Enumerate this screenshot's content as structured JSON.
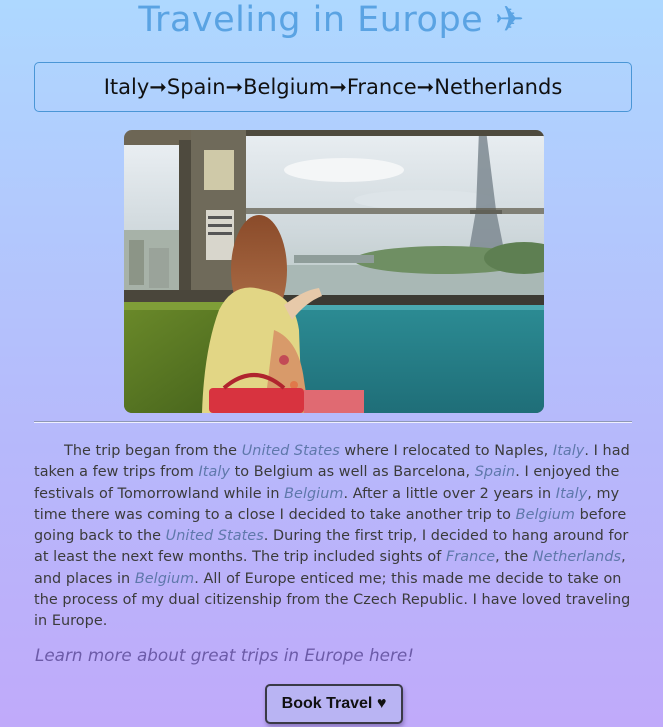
{
  "page": {
    "title": "Traveling in Europe ✈"
  },
  "route": {
    "text": "Italy➞Spain➞Belgium➞France➞Netherlands"
  },
  "photo": {
    "description_icon": "photo-woman-train-eiffel-tower"
  },
  "story": {
    "segments": [
      {
        "text": "The trip began from the ",
        "place": false
      },
      {
        "text": "United States",
        "place": true
      },
      {
        "text": " where I relocated to Naples, ",
        "place": false
      },
      {
        "text": "Italy",
        "place": true
      },
      {
        "text": ". I had taken a few trips from ",
        "place": false
      },
      {
        "text": "Italy",
        "place": true
      },
      {
        "text": " to Belgium as well as Barcelona, ",
        "place": false
      },
      {
        "text": "Spain",
        "place": true
      },
      {
        "text": ". I enjoyed the festivals of Tomorrowland while in ",
        "place": false
      },
      {
        "text": "Belgium",
        "place": true
      },
      {
        "text": ". After a little over 2 years in ",
        "place": false
      },
      {
        "text": "Italy",
        "place": true
      },
      {
        "text": ", my time there was coming to a close I decided to take another trip to ",
        "place": false
      },
      {
        "text": "Belgium",
        "place": true
      },
      {
        "text": " before going back to the ",
        "place": false
      },
      {
        "text": "United States",
        "place": true
      },
      {
        "text": ". During the first trip, I decided to hang around for at least the next few months. The trip included sights of ",
        "place": false
      },
      {
        "text": "France",
        "place": true
      },
      {
        "text": ", the ",
        "place": false
      },
      {
        "text": "Netherlands",
        "place": true
      },
      {
        "text": ", and places in ",
        "place": false
      },
      {
        "text": "Belgium",
        "place": true
      },
      {
        "text": ". All of Europe enticed me; this made me decide to take on the process of my dual citizenship from the Czech Republic. I have loved traveling in Europe.",
        "place": false
      }
    ]
  },
  "links": {
    "learn_more": "Learn more about great trips in Europe here!"
  },
  "actions": {
    "book_label": "Book Travel ♥"
  },
  "colors": {
    "title": "#5aa3e3",
    "place_highlight": "#5f78ab",
    "link": "#6c5ba8",
    "button_bg": "#b9b4f3"
  }
}
